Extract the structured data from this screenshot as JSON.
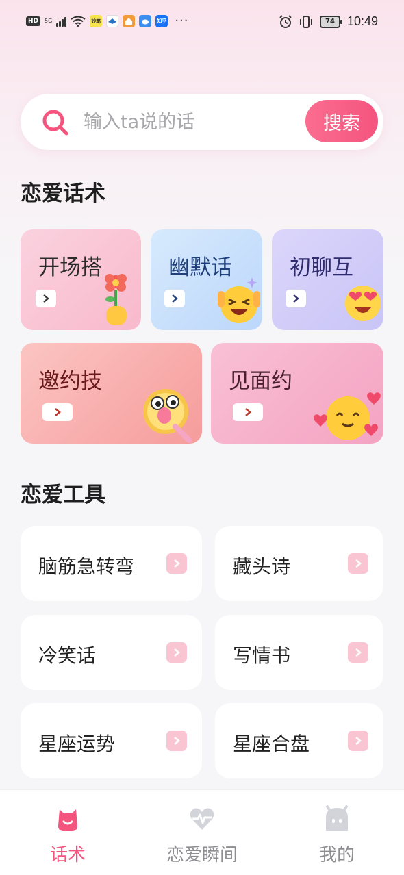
{
  "status_bar": {
    "left_chips": [
      "HD",
      "5G"
    ],
    "app_icons": [
      "妙笔",
      "知乎"
    ],
    "battery": "74",
    "time": "10:49"
  },
  "search": {
    "placeholder": "输入ta说的话",
    "value": "",
    "button_label": "搜索"
  },
  "section_talk": {
    "title": "恋爱话术",
    "cards": [
      {
        "label": "开场搭",
        "emoji": "🌷",
        "text_color": "#2b2b2b"
      },
      {
        "label": "幽默话",
        "emoji": "😆",
        "text_color": "#1f3f7a"
      },
      {
        "label": "初聊互",
        "emoji": "😍",
        "text_color": "#2f2d6e"
      },
      {
        "label": "邀约技",
        "emoji": "😮",
        "text_color": "#6a1a1a"
      },
      {
        "label": "见面约",
        "emoji": "🥰",
        "text_color": "#4a2030"
      }
    ]
  },
  "section_tools": {
    "title": "恋爱工具",
    "items": [
      {
        "label": "脑筋急转弯"
      },
      {
        "label": "藏头诗"
      },
      {
        "label": "冷笑话"
      },
      {
        "label": "写情书"
      },
      {
        "label": "星座运势"
      },
      {
        "label": "星座合盘"
      }
    ]
  },
  "bottom_nav": {
    "items": [
      {
        "label": "话术",
        "icon": "smile-bag-icon",
        "active": true
      },
      {
        "label": "恋爱瞬间",
        "icon": "heart-pulse-icon",
        "active": false
      },
      {
        "label": "我的",
        "icon": "ghost-face-icon",
        "active": false
      }
    ]
  },
  "colors": {
    "accent": "#f4557e",
    "tool_arrow_bg": "#f9c5d3"
  }
}
